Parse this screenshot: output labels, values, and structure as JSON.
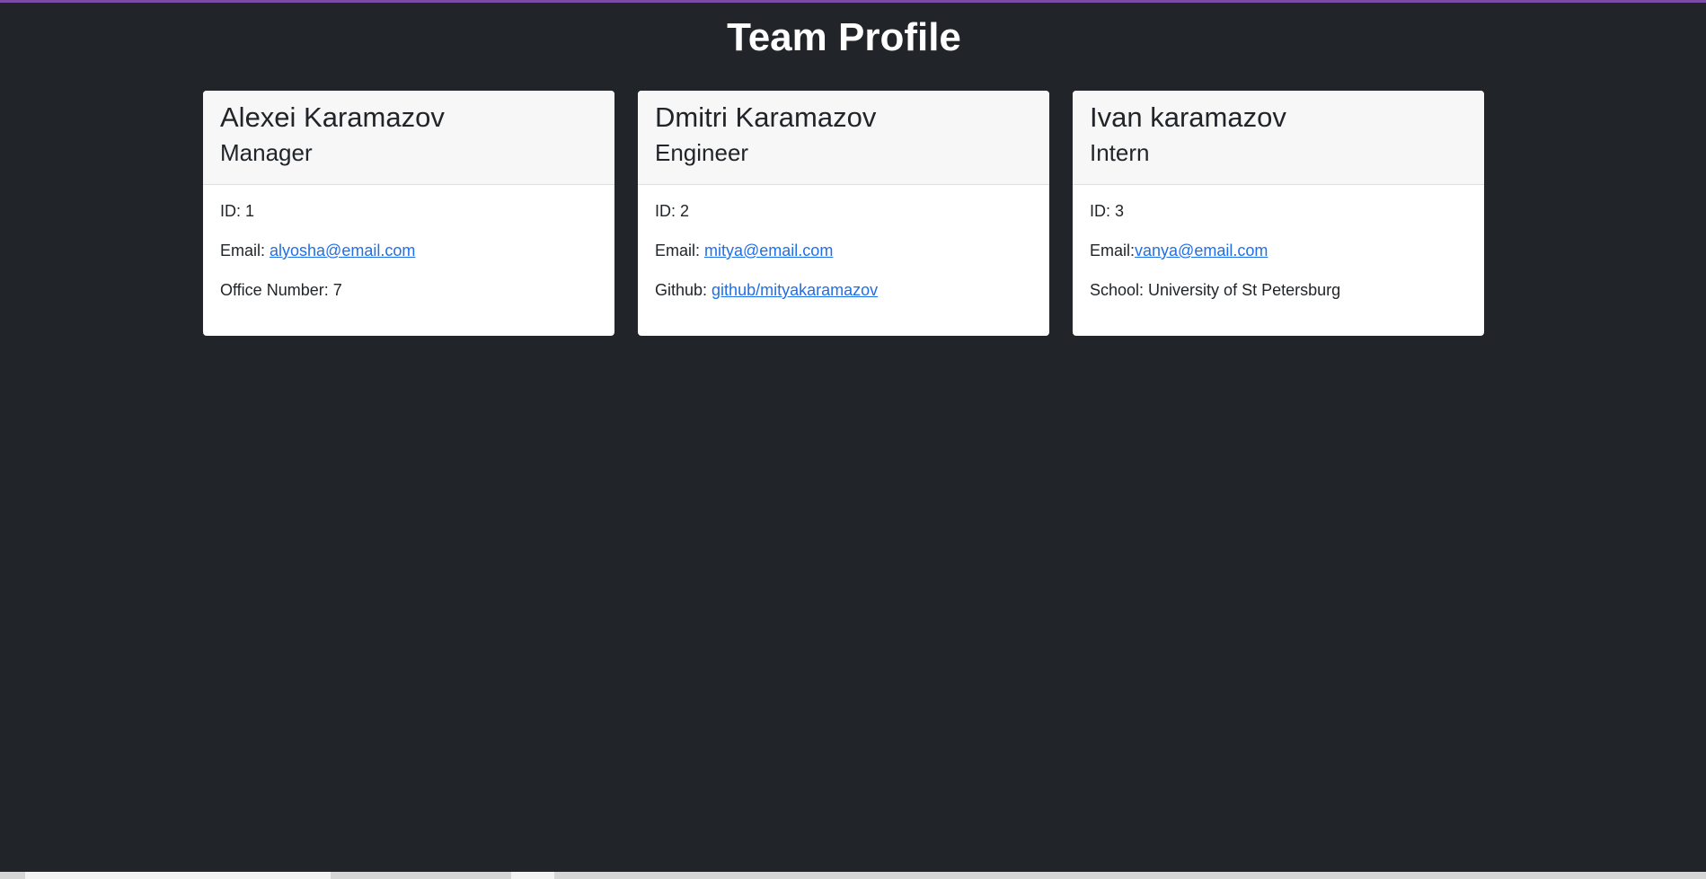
{
  "page": {
    "title": "Team Profile"
  },
  "colors": {
    "background": "#212429",
    "accent": "#7b4aa6",
    "card": "#ffffff",
    "card_header": "#f7f7f7",
    "link": "#1f6fe8"
  },
  "team": [
    {
      "name": "Alexei Karamazov",
      "role": "Manager",
      "id_text": "ID: 1",
      "email_label": "Email: ",
      "email": "alyosha@email.com",
      "extra_label": "Office Number: 7",
      "extra_link": ""
    },
    {
      "name": "Dmitri Karamazov",
      "role": "Engineer",
      "id_text": "ID: 2",
      "email_label": "Email: ",
      "email": "mitya@email.com",
      "extra_label": "Github: ",
      "extra_link": "github/mityakaramazov"
    },
    {
      "name": "Ivan karamazov",
      "role": "Intern",
      "id_text": "ID: 3",
      "email_label": "Email:",
      "email": "vanya@email.com",
      "extra_label": "School: University of St Petersburg",
      "extra_link": ""
    }
  ]
}
